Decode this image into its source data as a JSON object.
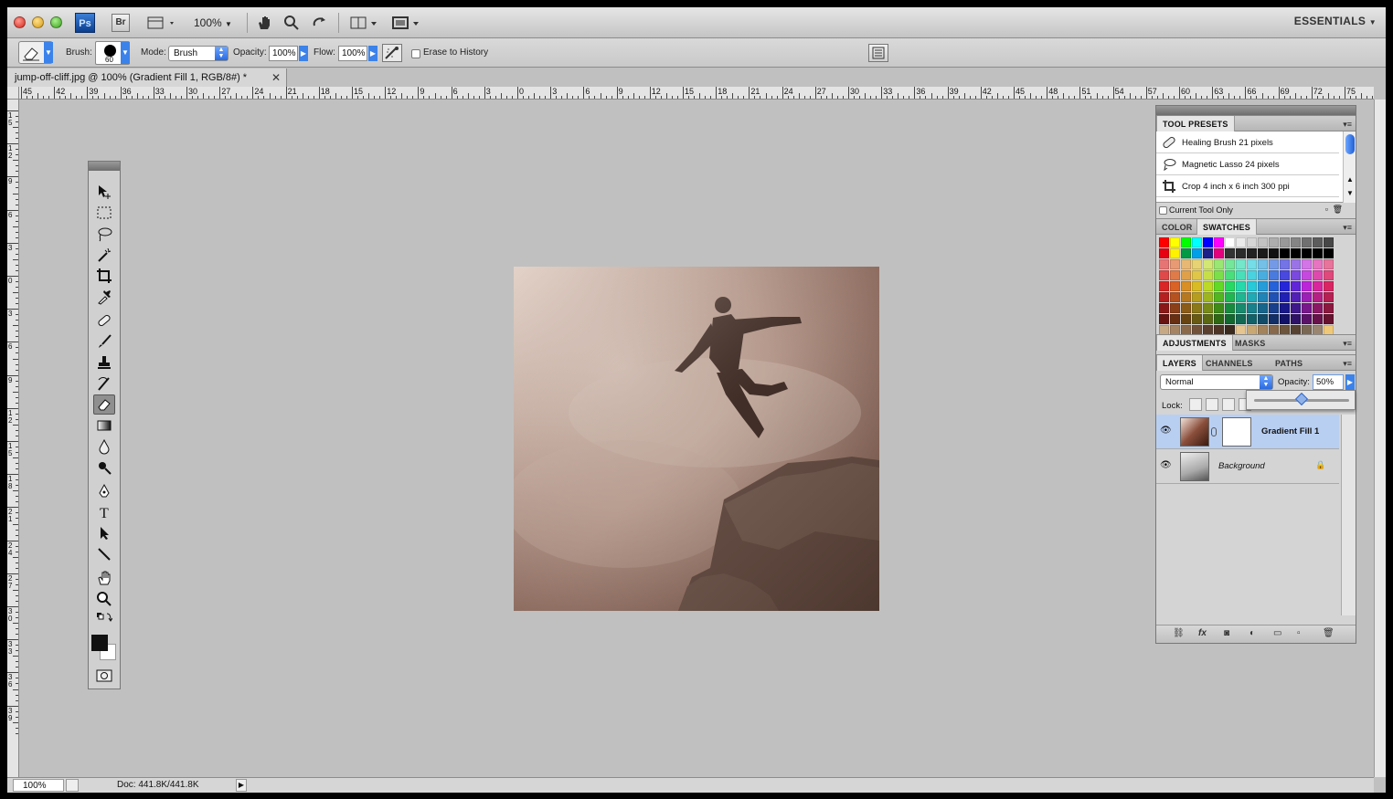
{
  "app": {
    "logo_ps": "Ps",
    "logo_br": "Br",
    "zoom_menu": "100%",
    "workspace": "ESSENTIALS"
  },
  "options_bar": {
    "brush_label": "Brush:",
    "brush_size": "60",
    "mode_label": "Mode:",
    "mode_value": "Brush",
    "opacity_label": "Opacity:",
    "opacity_value": "100%",
    "flow_label": "Flow:",
    "flow_value": "100%",
    "erase_to_history": "Erase to History"
  },
  "document": {
    "tab_title": "jump-off-cliff.jpg @ 100% (Gradient Fill 1, RGB/8#) *"
  },
  "ruler": {
    "h_labels": [
      "45",
      "42",
      "39",
      "36",
      "33",
      "30",
      "27",
      "24",
      "21",
      "18",
      "15",
      "12",
      "9",
      "6",
      "3",
      "0",
      "3",
      "6",
      "9",
      "12",
      "15",
      "18",
      "21",
      "24",
      "27",
      "30",
      "33",
      "36",
      "39",
      "42",
      "45",
      "48",
      "51",
      "54",
      "57",
      "60",
      "63",
      "66",
      "69",
      "72",
      "75"
    ],
    "v_labels": [
      "15",
      "12",
      "9",
      "6",
      "3",
      "0",
      "3",
      "6",
      "9",
      "12",
      "15",
      "18",
      "21",
      "24",
      "27",
      "30",
      "33",
      "36",
      "39"
    ]
  },
  "tool_presets": {
    "tab": "TOOL PRESETS",
    "items": [
      {
        "label": "Healing Brush 21 pixels",
        "icon": "healing-brush-icon"
      },
      {
        "label": "Magnetic Lasso 24 pixels",
        "icon": "magnetic-lasso-icon"
      },
      {
        "label": "Crop 4 inch x 6 inch 300 ppi",
        "icon": "crop-icon"
      }
    ],
    "current_tool_only": "Current Tool Only"
  },
  "color_panel": {
    "tab_color": "COLOR",
    "tab_swatches": "SWATCHES"
  },
  "adjustments_panel": {
    "tab_adjustments": "ADJUSTMENTS",
    "tab_masks": "MASKS"
  },
  "layers_panel": {
    "tab_layers": "LAYERS",
    "tab_channels": "CHANNELS",
    "tab_paths": "PATHS",
    "blend_mode": "Normal",
    "opacity_label": "Opacity:",
    "opacity_value": "50%",
    "opacity_fraction": 0.5,
    "lock_label": "Lock:",
    "layers": [
      {
        "name": "Gradient Fill 1",
        "selected": true
      },
      {
        "name": "Background",
        "selected": false
      }
    ]
  },
  "status_bar": {
    "zoom": "100%",
    "doc_size": "Doc: 441.8K/441.8K"
  },
  "colors": {
    "accent": "#3b82ea",
    "selection": "#b9cff2",
    "canvas_bg": "#c0c0c0"
  }
}
